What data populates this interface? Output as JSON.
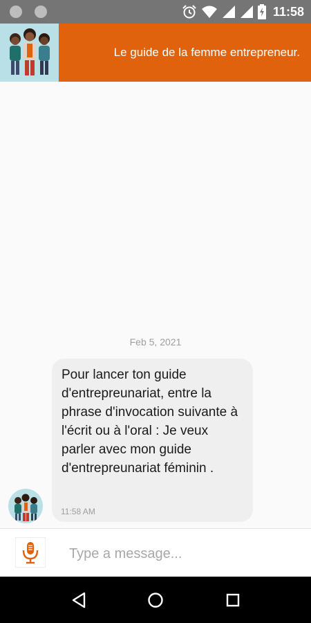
{
  "status_bar": {
    "time": "11:58",
    "icons": [
      "alarm-icon",
      "wifi-icon",
      "signal-icon",
      "signal-icon",
      "battery-charging-icon"
    ]
  },
  "header": {
    "title": "Le guide de la femme entrepreneur.",
    "logo_icon": "women-group-logo"
  },
  "chat": {
    "date": "Feb 5, 2021",
    "messages": [
      {
        "text": "Pour lancer ton guide d'entrepreunariat, entre la phrase d'invocation suivante à l'écrit ou à l'oral : Je veux parler avec mon guide d'entrepreunariat féminin .",
        "time": "11:58 AM"
      }
    ]
  },
  "composer": {
    "placeholder": "Type a message...",
    "value": ""
  },
  "colors": {
    "header_bg": "#e1620c",
    "status_bg": "#757575",
    "bubble_bg": "#efefef",
    "mic_accent": "#e1620c"
  }
}
